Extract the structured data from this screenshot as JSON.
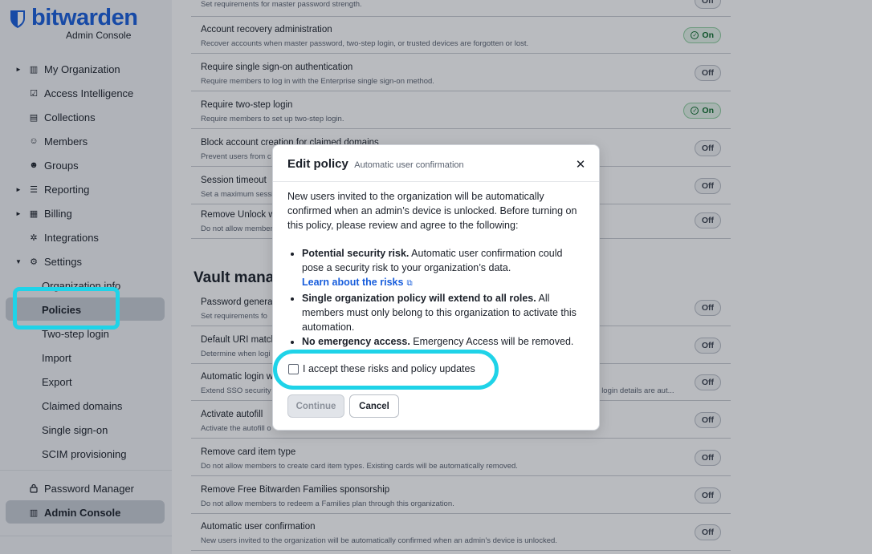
{
  "brand": {
    "name": "bitwarden",
    "subtitle": "Admin Console",
    "accent": "#175ddc"
  },
  "sidebar": {
    "items": [
      {
        "label": "My Organization",
        "icon": "building-icon",
        "glyph": "▥",
        "caret": "►"
      },
      {
        "label": "Access Intelligence",
        "icon": "chart-icon",
        "glyph": "☑"
      },
      {
        "label": "Collections",
        "icon": "collections-icon",
        "glyph": "▤"
      },
      {
        "label": "Members",
        "icon": "user-icon",
        "glyph": "☺"
      },
      {
        "label": "Groups",
        "icon": "users-icon",
        "glyph": "☻"
      },
      {
        "label": "Reporting",
        "icon": "sliders-icon",
        "glyph": "☰",
        "caret": "►"
      },
      {
        "label": "Billing",
        "icon": "billing-icon",
        "glyph": "▦",
        "caret": "►"
      },
      {
        "label": "Integrations",
        "icon": "integrations-icon",
        "glyph": "✲"
      },
      {
        "label": "Settings",
        "icon": "gear-icon",
        "glyph": "⚙",
        "caret": "▼"
      }
    ],
    "settings_children": [
      "Organization info",
      "Policies",
      "Two-step login",
      "Import",
      "Export",
      "Claimed domains",
      "Single sign-on",
      "SCIM provisioning"
    ],
    "active_child": "Policies",
    "products": [
      {
        "label": "Password Manager",
        "icon": "lock-icon",
        "glyph": "🔒"
      },
      {
        "label": "Admin Console",
        "icon": "building-icon",
        "glyph": "▥"
      }
    ]
  },
  "policies": {
    "top_fragment": "Set requirements for master password strength.",
    "rows_top": [
      {
        "title": "Account recovery administration",
        "desc": "Recover accounts when master password, two-step login, or trusted devices are forgotten or lost.",
        "status": "On"
      },
      {
        "title": "Require single sign-on authentication",
        "desc": "Require members to log in with the Enterprise single sign-on method.",
        "status": "Off"
      },
      {
        "title": "Require two-step login",
        "desc": "Require members to set up two-step login.",
        "status": "On"
      },
      {
        "title": "Block account creation for claimed domains",
        "desc": "Prevent users from c",
        "status": "Off"
      },
      {
        "title": "Session timeout",
        "desc": "Set a maximum sessi",
        "status": "Off"
      },
      {
        "title": "Remove Unlock w",
        "desc": "Do not allow member",
        "status": "Off"
      }
    ],
    "vault_section_title": "Vault manag",
    "rows_vault": [
      {
        "title": "Password generat",
        "desc": "Set requirements fo",
        "status": "Off"
      },
      {
        "title": "Default URI match",
        "desc": "Determine when logi",
        "status": "Off"
      },
      {
        "title": "Automatic login w",
        "desc": "Extend SSO security",
        "desc_tail": "eir login details are aut...",
        "status": "Off"
      },
      {
        "title": "Activate autofill",
        "desc": "Activate the autofill o",
        "status": "Off"
      },
      {
        "title": "Remove card item type",
        "desc": "Do not allow members to create card item types. Existing cards will be automatically removed.",
        "status": "Off"
      },
      {
        "title": "Remove Free Bitwarden Families sponsorship",
        "desc": "Do not allow members to redeem a Families plan through this organization.",
        "status": "Off"
      },
      {
        "title": "Automatic user confirmation",
        "desc": "New users invited to the organization will be automatically confirmed when an admin’s device is unlocked.",
        "status": "Off"
      }
    ]
  },
  "dialog": {
    "title": "Edit policy",
    "subtitle": "Automatic user confirmation",
    "intro": "New users invited to the organization will be automatically confirmed when an admin’s device is unlocked. Before turning on this policy, please review and agree to the following:",
    "bullets": [
      {
        "bold": "Potential security risk.",
        "text": " Automatic user confirmation could pose a security risk to your organization’s data.",
        "link": "Learn about the risks"
      },
      {
        "bold": "Single organization policy will extend to all roles.",
        "text": " All members must only belong to this organization to activate this automation."
      },
      {
        "bold": "No emergency access.",
        "text": " Emergency Access will be removed."
      }
    ],
    "checkbox_label": "I accept these risks and policy updates",
    "continue_label": "Continue",
    "cancel_label": "Cancel",
    "close_glyph": "✕"
  },
  "colors": {
    "highlight": "#1fd3e8",
    "on_badge": "#0b6b2a"
  }
}
